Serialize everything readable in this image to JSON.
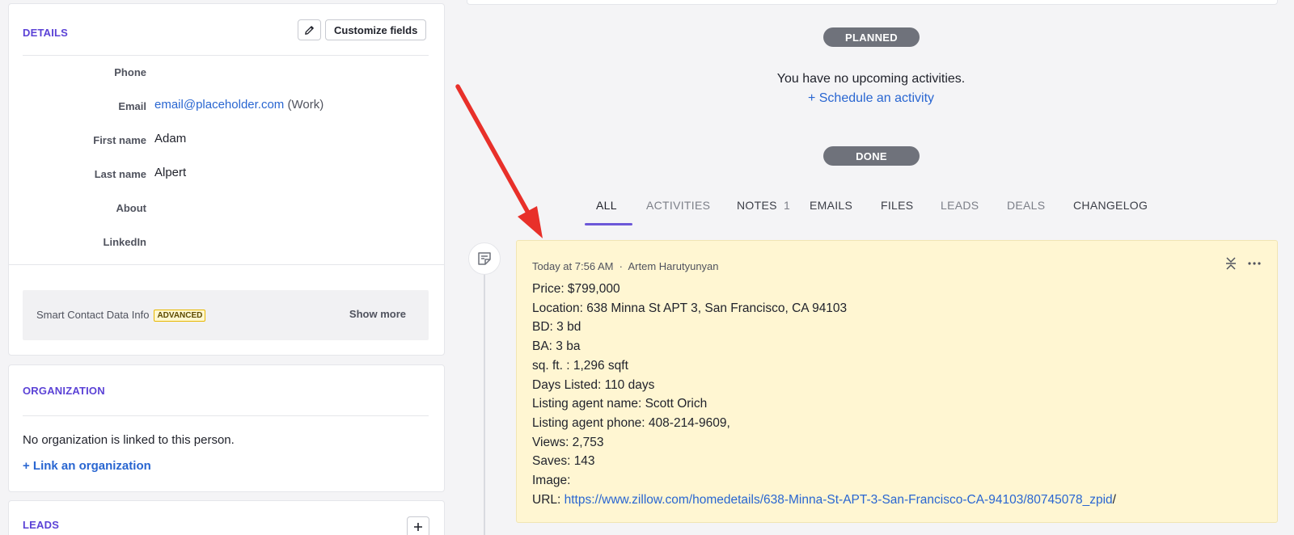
{
  "details": {
    "title": "DETAILS",
    "customize_label": "Customize fields",
    "fields": [
      {
        "label": "Phone",
        "value": ""
      },
      {
        "label": "Email",
        "value": "email@placeholder.com",
        "suffix": "(Work)"
      },
      {
        "label": "First name",
        "value": "Adam"
      },
      {
        "label": "Last name",
        "value": "Alpert"
      },
      {
        "label": "About",
        "value": ""
      },
      {
        "label": "LinkedIn",
        "value": ""
      }
    ],
    "smart": {
      "label": "Smart Contact Data Info",
      "badge": "ADVANCED",
      "show_more": "Show more"
    }
  },
  "organization": {
    "title": "ORGANIZATION",
    "empty_text": "No organization is linked to this person.",
    "link_label": "+ Link an organization"
  },
  "leads": {
    "title": "LEADS"
  },
  "timeline": {
    "planned_label": "PLANNED",
    "no_activities": "You have no upcoming activities.",
    "schedule_link": "+ Schedule an activity",
    "done_label": "DONE"
  },
  "tabs": [
    {
      "label": "ALL"
    },
    {
      "label": "ACTIVITIES"
    },
    {
      "label": "NOTES",
      "count": "1"
    },
    {
      "label": "EMAILS"
    },
    {
      "label": "FILES"
    },
    {
      "label": "LEADS"
    },
    {
      "label": "DEALS"
    },
    {
      "label": "CHANGELOG"
    }
  ],
  "note": {
    "meta": "Today at 7:56 AM  ·  Artem Harutyunyan",
    "lines": [
      "Price: $799,000",
      "Location: 638 Minna St APT 3, San Francisco, CA 94103",
      "BD: 3 bd",
      "BA: 3 ba",
      "sq. ft. : 1,296 sqft",
      "Days Listed: 110 days",
      "Listing agent name: Scott Orich",
      "Listing agent phone: 408-214-9609,",
      "Views: 2,753",
      "Saves: 143",
      "Image:"
    ],
    "url_prefix": "URL: ",
    "url": "https://www.zillow.com/homedetails/638-Minna-St-APT-3-San-Francisco-CA-94103/80745078_zpid",
    "url_suffix": "/"
  },
  "colors": {
    "accent": "#5b42d6",
    "link": "#2966d1",
    "note_bg": "#fff6d2",
    "pill": "#6f727b",
    "arrow": "#e8302a"
  }
}
